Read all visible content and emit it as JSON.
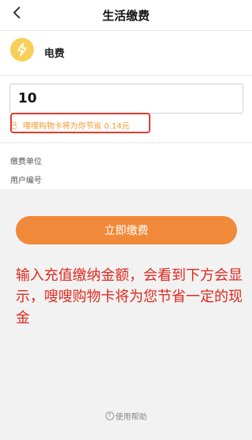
{
  "header": {
    "title": "生活缴费",
    "back_icon": "chevron-left-icon"
  },
  "bill_type": {
    "name": "电费",
    "icon": "lightning-bolt-icon",
    "icon_color": "#f8cf58"
  },
  "amount_input": {
    "value": "10"
  },
  "savings_tip": {
    "prefix": "巳",
    "text": "嗖嗖购物卡将为你节省 0.14元",
    "color": "#f39a2b"
  },
  "info": {
    "unit_label": "缴费单位",
    "account_label": "用户编号"
  },
  "pay_button": {
    "label": "立即缴费",
    "color": "#f08a3a"
  },
  "annotation": {
    "text": "输入充值缴纳金额，会看到下方会显示，嗖嗖购物卡将为您节省一定的现金",
    "color": "#e0291f"
  },
  "help": {
    "label": "使用帮助",
    "icon": "help-circle-icon"
  }
}
